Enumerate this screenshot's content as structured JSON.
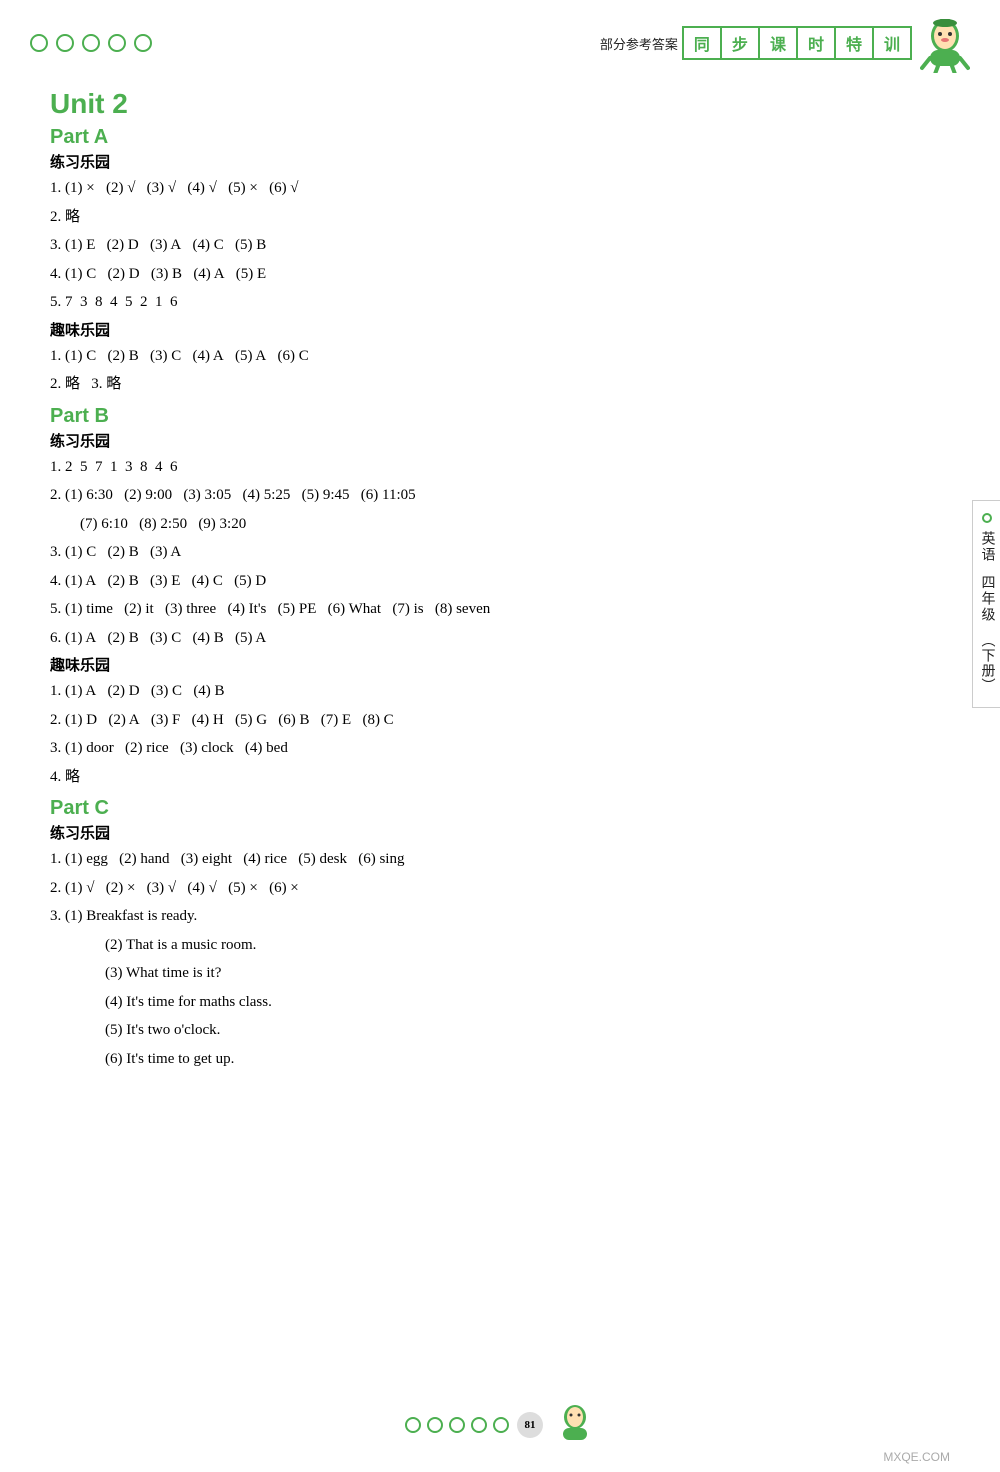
{
  "header": {
    "circles_count": 5,
    "label": "部分参考答案",
    "boxes": [
      "同",
      "步",
      "课",
      "时",
      "特",
      "训"
    ]
  },
  "unit": {
    "title": "Unit  2",
    "parts": [
      {
        "name": "Part A",
        "sections": [
          {
            "title": "练习乐园",
            "lines": [
              "1. (1) ×   (2) √   (3) √   (4) √   (5) ×   (6) √",
              "2. 略",
              "3. (1) E   (2) D   (3) A   (4) C   (5) B",
              "4. (1) C   (2) D   (3) B   (4) A   (5) E",
              "5. 7  3  8  4  5  2  1  6"
            ]
          },
          {
            "title": "趣味乐园",
            "lines": [
              "1. (1) C   (2) B   (3) C   (4) A   (5) A   (6) C",
              "2. 略   3. 略"
            ]
          }
        ]
      },
      {
        "name": "Part B",
        "sections": [
          {
            "title": "练习乐园",
            "lines": [
              "1. 2  5  7  1  3  8  4  6",
              "2. (1) 6:30   (2) 9:00   (3) 3:05   (4) 5:25   (5) 9:45   (6) 11:05",
              "   (7) 6:10   (8) 2:50   (9) 3:20",
              "3. (1) C   (2) B   (3) A",
              "4. (1) A   (2) B   (3) E   (4) C   (5) D",
              "5. (1) time   (2) it   (3) three   (4) It's   (5) PE   (6) What   (7) is   (8) seven",
              "6. (1) A   (2) B   (3) C   (4) B   (5) A"
            ]
          },
          {
            "title": "趣味乐园",
            "lines": [
              "1. (1) A   (2) D   (3) C   (4) B",
              "2. (1) D   (2) A   (3) F   (4) H   (5) G   (6) B   (7) E   (8) C",
              "3. (1) door   (2) rice   (3) clock   (4) bed",
              "4. 略"
            ]
          }
        ]
      },
      {
        "name": "Part C",
        "sections": [
          {
            "title": "练习乐园",
            "lines": [
              "1. (1) egg   (2) hand   (3) eight   (4) rice   (5) desk   (6) sing",
              "2. (1) √   (2) ×   (3) √   (4) √   (5) ×   (6) ×",
              "3. (1) Breakfast is ready.",
              "   (2) That is a music room.",
              "   (3) What time is it?",
              "   (4) It's time for maths class.",
              "   (5) It's two o'clock.",
              "   (6) It's time to get up."
            ]
          }
        ]
      }
    ]
  },
  "sidebar": {
    "subject": "英语",
    "grade": "四年级",
    "volume": "（下册）"
  },
  "footer": {
    "page": "81",
    "circles_count": 5,
    "watermark": "MXQE.COM"
  }
}
